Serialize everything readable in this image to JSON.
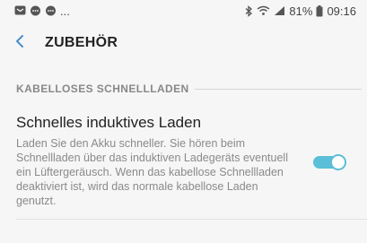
{
  "status_bar": {
    "icons_left": [
      "message-icon",
      "chat-icon",
      "chat-icon"
    ],
    "ellipsis": "...",
    "icons_right": [
      "bluetooth-icon",
      "wifi-icon",
      "signal-icon"
    ],
    "battery": "81%",
    "time": "09:16"
  },
  "header": {
    "title": "ZUBEHÖR"
  },
  "section": {
    "label": "KABELLOSES SCHNELLLADEN"
  },
  "setting": {
    "title": "Schnelles induktives Laden",
    "description": "Laden Sie den Akku schneller. Sie hören beim Schnellladen über das induktiven Ladegeräts eventuell ein Lüftergeräusch. Wenn das kabellose Schnellladen deaktiviert ist, wird das normale kabellose Laden genutzt.",
    "enabled": true
  },
  "colors": {
    "accent": "#5bbfd7",
    "back_arrow": "#4a8ec9",
    "background": "#f6f6f6"
  }
}
